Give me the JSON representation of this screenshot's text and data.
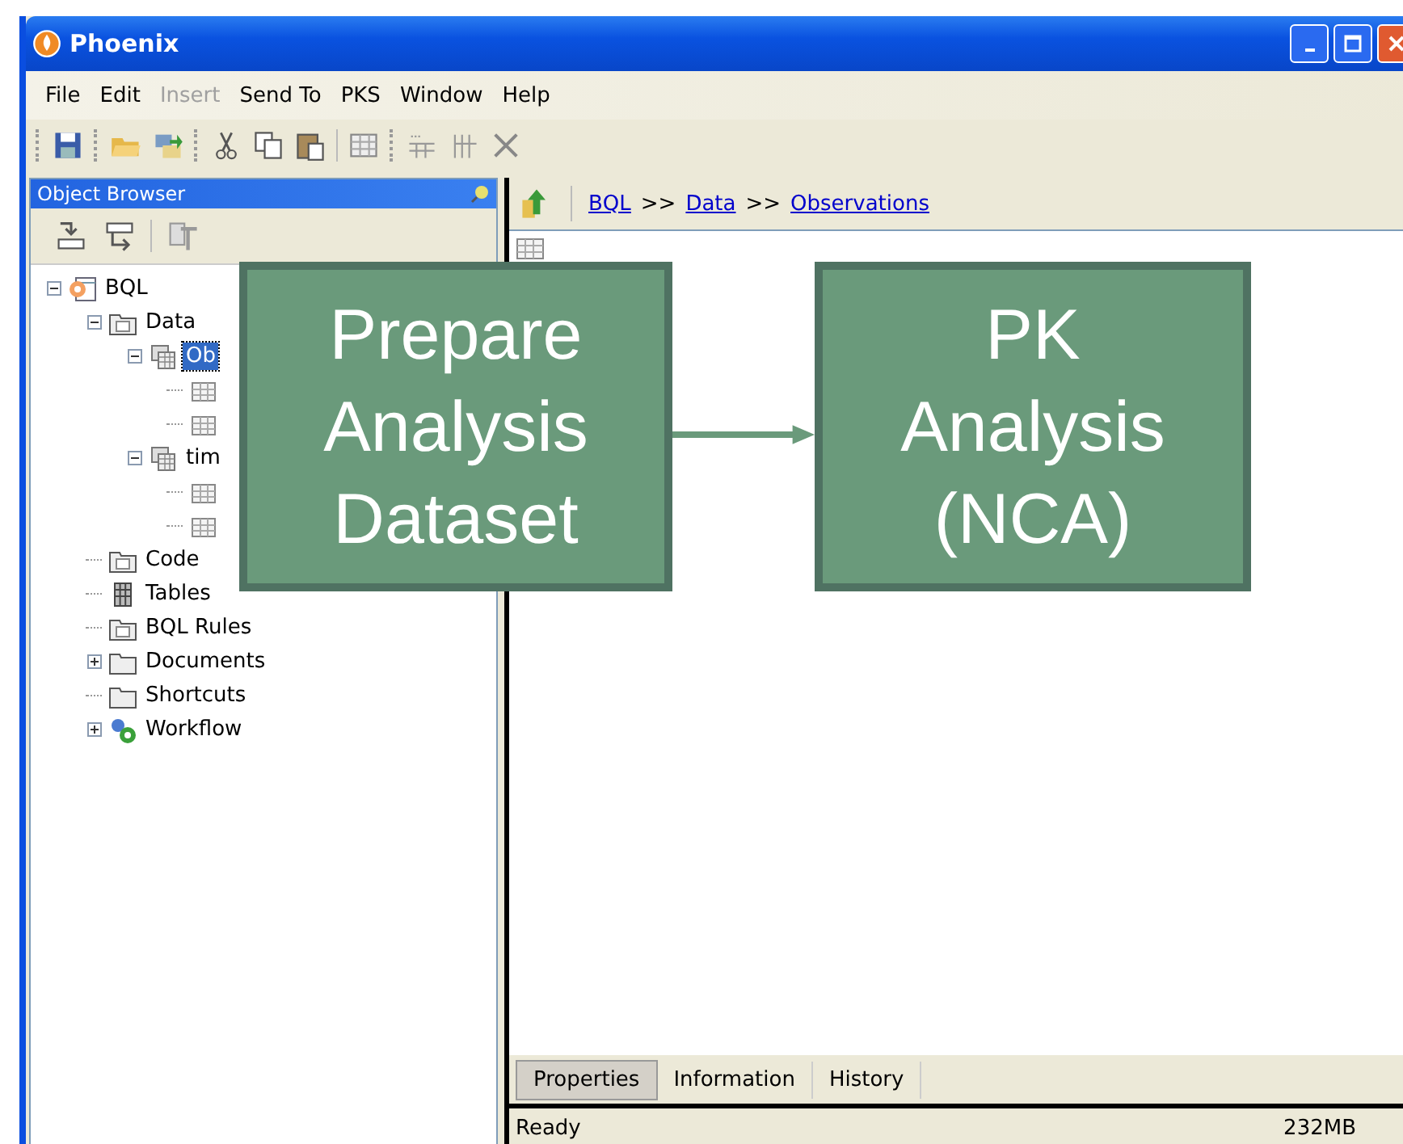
{
  "window": {
    "title": "Phoenix"
  },
  "menu": [
    {
      "label": "File",
      "disabled": false
    },
    {
      "label": "Edit",
      "disabled": false
    },
    {
      "label": "Insert",
      "disabled": true
    },
    {
      "label": "Send To",
      "disabled": false
    },
    {
      "label": "PKS",
      "disabled": false
    },
    {
      "label": "Window",
      "disabled": false
    },
    {
      "label": "Help",
      "disabled": false
    }
  ],
  "object_browser": {
    "title": "Object Browser",
    "tree": [
      {
        "label": "BQL",
        "kind": "app",
        "expanded": true,
        "selected": false,
        "children": [
          {
            "label": "Data",
            "kind": "data",
            "expanded": true,
            "selected": false,
            "children": [
              {
                "label": "Ob",
                "kind": "dataset",
                "expanded": true,
                "selected": true,
                "children": [
                  {
                    "kind": "table"
                  },
                  {
                    "kind": "table"
                  }
                ]
              },
              {
                "label": "tim",
                "kind": "dataset",
                "expanded": true,
                "selected": false,
                "children": [
                  {
                    "kind": "table"
                  },
                  {
                    "kind": "table"
                  }
                ]
              }
            ]
          },
          {
            "label": "Code",
            "kind": "code",
            "selected": false
          },
          {
            "label": "Tables",
            "kind": "tables",
            "selected": false
          },
          {
            "label": "BQL Rules",
            "kind": "rules",
            "selected": false
          },
          {
            "label": "Documents",
            "kind": "folder",
            "expanded": false,
            "selected": false
          },
          {
            "label": "Shortcuts",
            "kind": "folder",
            "selected": false
          },
          {
            "label": "Workflow",
            "kind": "workflow",
            "expanded": false,
            "selected": false
          }
        ]
      }
    ]
  },
  "breadcrumb": [
    "BQL",
    "Data",
    "Observations"
  ],
  "breadcrumb_separator": ">>",
  "tabs": [
    {
      "label": "Properties",
      "selected": true
    },
    {
      "label": "Information",
      "selected": false
    },
    {
      "label": "History",
      "selected": false
    }
  ],
  "status_bar": {
    "text": "Ready",
    "memory": "232MB"
  },
  "flow": [
    {
      "label": "Prepare Analysis Dataset"
    },
    {
      "label": "PK Analysis (NCA)"
    }
  ]
}
